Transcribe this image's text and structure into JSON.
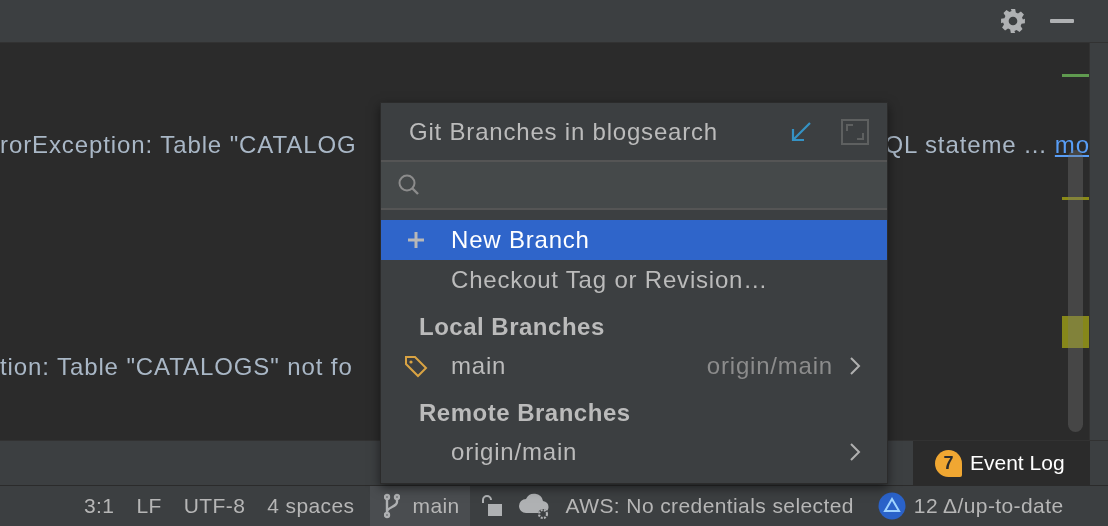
{
  "editor": {
    "lines": [
      {
        "text": "rorException: Table \"CATALOG",
        "tail": "QL stateme ...",
        "link": "mo"
      },
      {
        "text": "tion: Table \"CATALOGS\" not fo"
      }
    ]
  },
  "popup": {
    "title": "Git Branches in blogsearch",
    "actions": [
      {
        "kind": "new",
        "label": "New Branch",
        "selected": true
      },
      {
        "kind": "plain",
        "label": "Checkout Tag or Revision…",
        "selected": false
      }
    ],
    "groups": [
      {
        "title": "Local Branches",
        "branches": [
          {
            "name": "main",
            "tracking": "origin/main",
            "current": true
          }
        ]
      },
      {
        "title": "Remote Branches",
        "branches": [
          {
            "name": "origin/main",
            "current": false
          }
        ]
      }
    ]
  },
  "event_log": {
    "badge": "7",
    "label": "Event Log"
  },
  "status_bar": {
    "items": [
      "3:1",
      "LF",
      "UTF-8",
      "4 spaces"
    ],
    "branch": "main",
    "aws": "AWS: No credentials selected",
    "vcs": "12 Δ/up-to-date"
  }
}
